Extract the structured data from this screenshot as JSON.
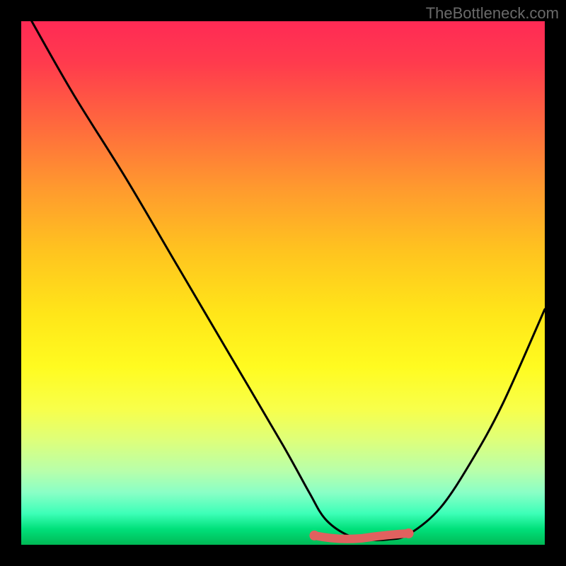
{
  "watermark": "TheBottleneck.com",
  "chart_data": {
    "type": "line",
    "title": "",
    "xlabel": "",
    "ylabel": "",
    "xlim": [
      0,
      100
    ],
    "ylim": [
      0,
      100
    ],
    "series": [
      {
        "name": "curve",
        "x": [
          2,
          10,
          20,
          30,
          40,
          50,
          55,
          58,
          62,
          66,
          70,
          74,
          80,
          86,
          92,
          100
        ],
        "values": [
          100,
          86,
          70,
          53,
          36,
          19,
          10,
          5,
          2,
          1,
          1,
          2,
          7,
          16,
          27,
          45
        ]
      }
    ],
    "highlighted_segment": {
      "x_range": [
        56,
        74
      ],
      "y": 1.5
    },
    "background_gradient": {
      "direction": "top-to-bottom",
      "stops": [
        {
          "pct": 0,
          "color": "#ff2a55"
        },
        {
          "pct": 8,
          "color": "#ff3b4d"
        },
        {
          "pct": 20,
          "color": "#ff6a3d"
        },
        {
          "pct": 32,
          "color": "#ff9a2e"
        },
        {
          "pct": 44,
          "color": "#ffc41f"
        },
        {
          "pct": 56,
          "color": "#ffe619"
        },
        {
          "pct": 66,
          "color": "#fffb20"
        },
        {
          "pct": 74,
          "color": "#f8ff4a"
        },
        {
          "pct": 80,
          "color": "#deff7a"
        },
        {
          "pct": 86,
          "color": "#b7ffab"
        },
        {
          "pct": 90,
          "color": "#8affc6"
        },
        {
          "pct": 94,
          "color": "#3dffb8"
        },
        {
          "pct": 97,
          "color": "#00e07a"
        },
        {
          "pct": 100,
          "color": "#00b955"
        }
      ]
    },
    "highlight_color": "#e0615f",
    "curve_color": "#000000"
  }
}
